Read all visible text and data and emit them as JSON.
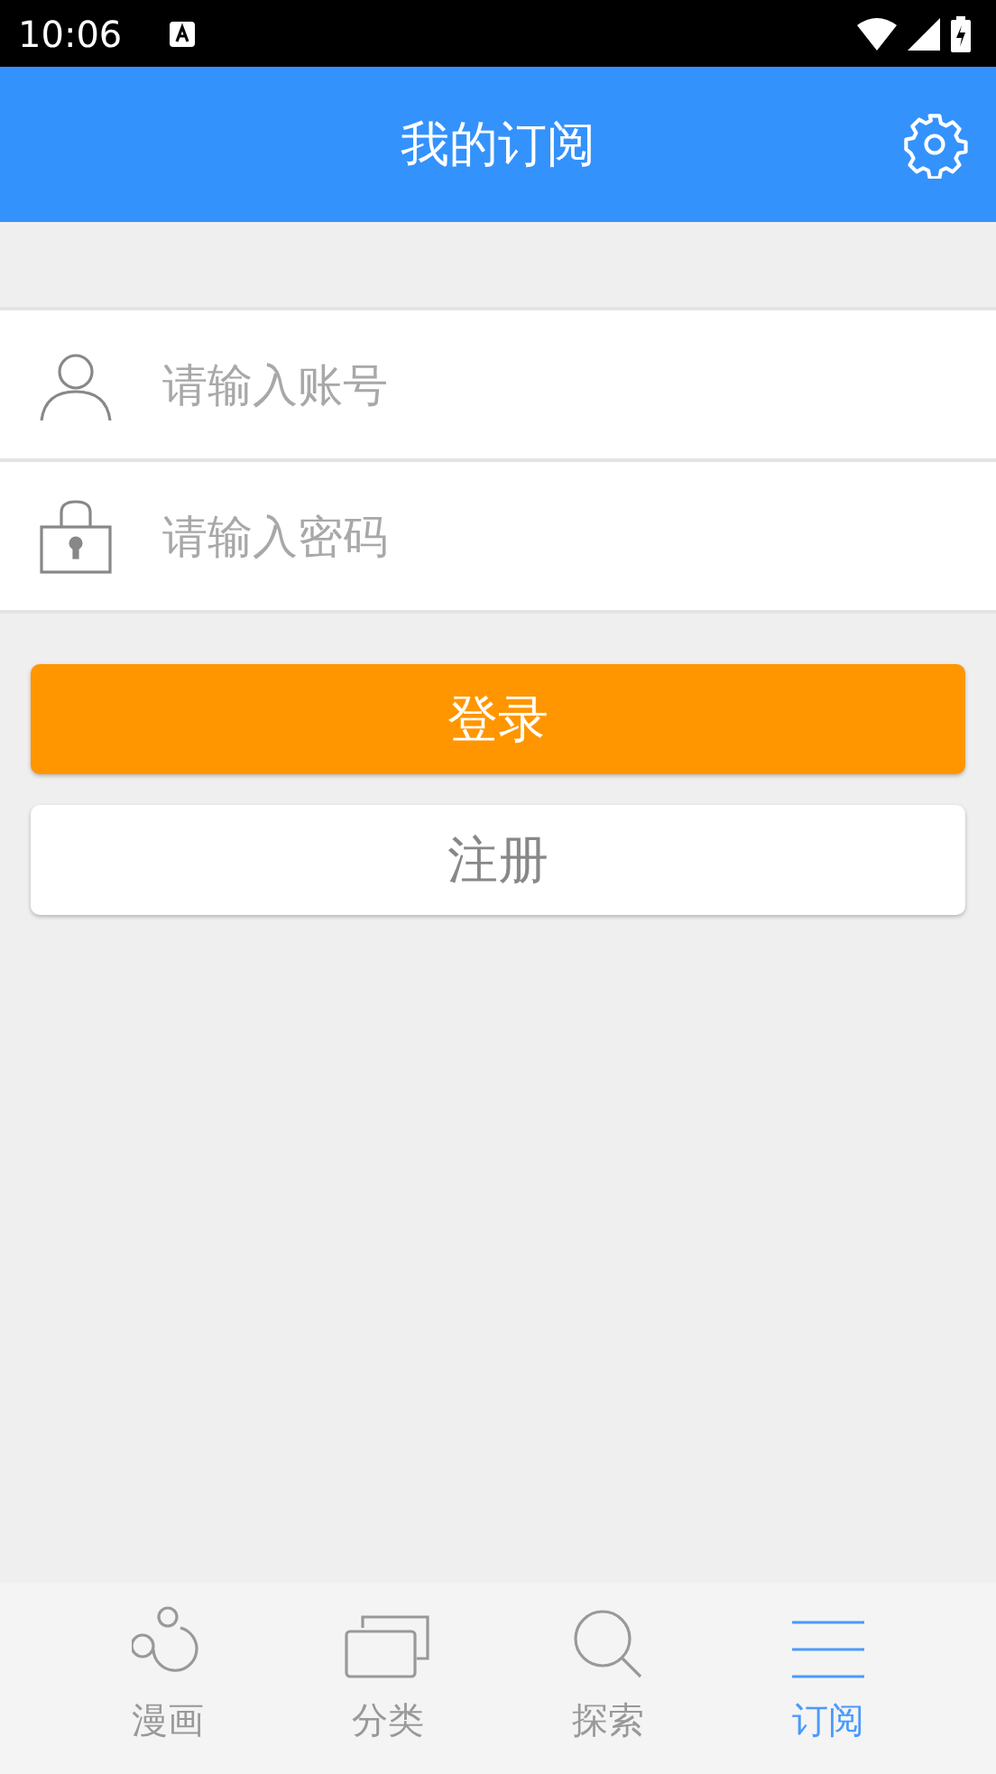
{
  "status_bar": {
    "time": "10:06"
  },
  "header": {
    "title": "我的订阅"
  },
  "fields": [
    {
      "kind": "user",
      "placeholder": "请输入账号"
    },
    {
      "kind": "lock",
      "placeholder": "请输入密码"
    }
  ],
  "buttons": [
    {
      "kind": "primary",
      "label": "登录"
    },
    {
      "kind": "secondary",
      "label": "注册"
    }
  ],
  "tabs": [
    {
      "kind": "comic",
      "label": "漫画",
      "selected": false
    },
    {
      "kind": "category",
      "label": "分类",
      "selected": false
    },
    {
      "kind": "search",
      "label": "探索",
      "selected": false
    },
    {
      "kind": "list",
      "label": "订阅",
      "selected": true
    }
  ]
}
